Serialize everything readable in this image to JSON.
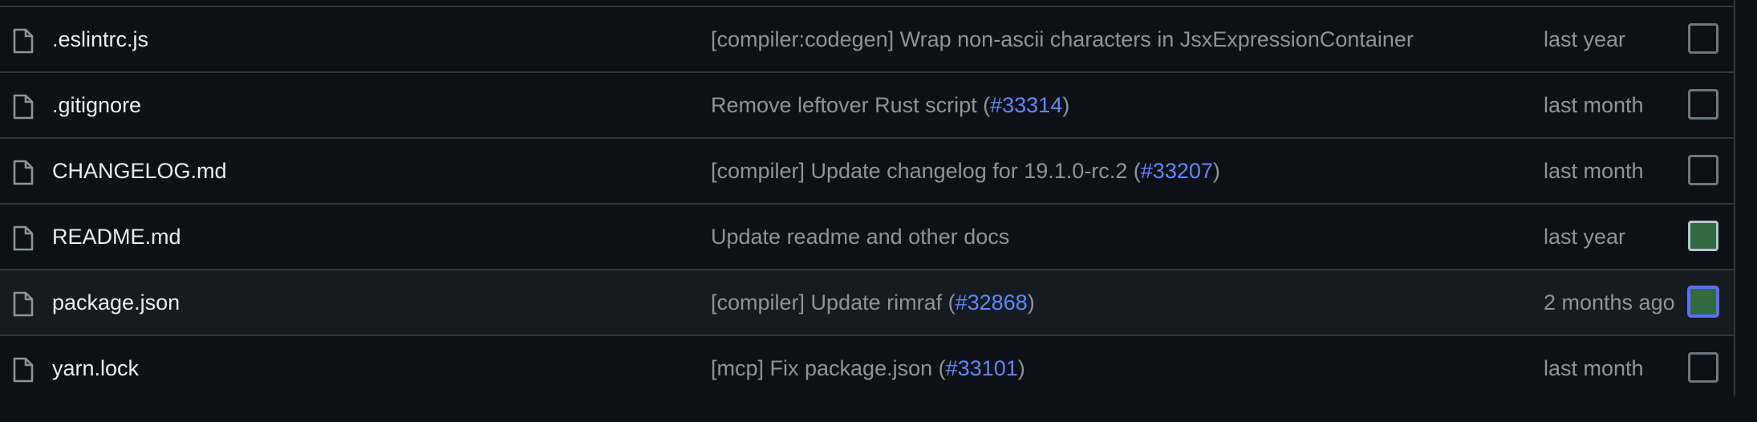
{
  "colors": {
    "background": "#0d1117",
    "hover_row": "#161b22",
    "border": "#30363d",
    "text_primary": "#e6edf3",
    "text_muted": "#8b949e",
    "link": "#5f87f7",
    "checked_fill": "#2f6b42",
    "focus_ring": "#5b6ef5"
  },
  "rows": [
    {
      "icon": "file-icon",
      "name": ".eslintrc.js",
      "commit_prefix": "[compiler:codegen] Wrap non-ascii characters in JsxExpressionContainer",
      "commit_link": "",
      "commit_suffix": "",
      "date": "last year",
      "checked": false,
      "focused": false
    },
    {
      "icon": "file-icon",
      "name": ".gitignore",
      "commit_prefix": "Remove leftover Rust script (",
      "commit_link": "#33314",
      "commit_suffix": ")",
      "date": "last month",
      "checked": false,
      "focused": false
    },
    {
      "icon": "file-icon",
      "name": "CHANGELOG.md",
      "commit_prefix": "[compiler] Update changelog for 19.1.0-rc.2 (",
      "commit_link": "#33207",
      "commit_suffix": ")",
      "date": "last month",
      "checked": false,
      "focused": false
    },
    {
      "icon": "file-icon",
      "name": "README.md",
      "commit_prefix": "Update readme and other docs",
      "commit_link": "",
      "commit_suffix": "",
      "date": "last year",
      "checked": true,
      "focused": false
    },
    {
      "icon": "file-icon",
      "name": "package.json",
      "commit_prefix": "[compiler] Update rimraf (",
      "commit_link": "#32868",
      "commit_suffix": ")",
      "date": "2 months ago",
      "checked": true,
      "focused": true
    },
    {
      "icon": "file-icon",
      "name": "yarn.lock",
      "commit_prefix": "[mcp] Fix package.json (",
      "commit_link": "#33101",
      "commit_suffix": ")",
      "date": "last month",
      "checked": false,
      "focused": false
    }
  ]
}
